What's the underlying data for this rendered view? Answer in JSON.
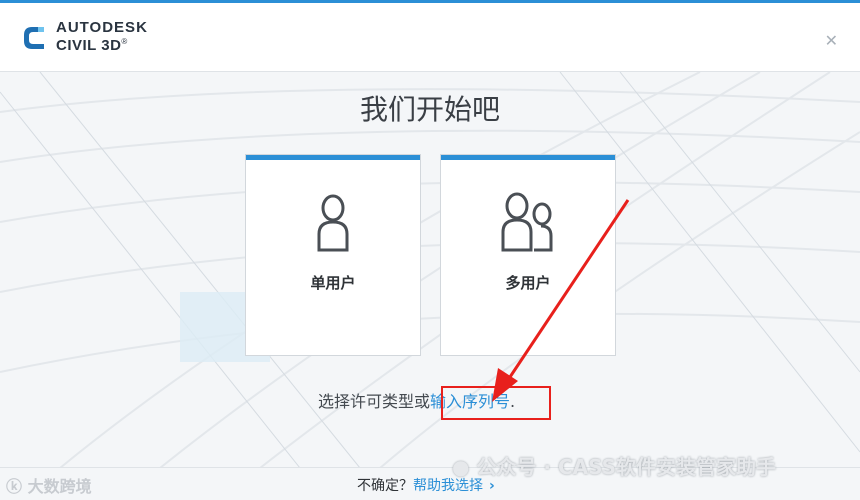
{
  "header": {
    "brand_line1": "AUTODESK",
    "brand_line2": "CIVIL 3D",
    "trademark": "®",
    "close_icon": "close-icon",
    "accent_color": "#2b8fd6"
  },
  "main": {
    "title": "我们开始吧",
    "cards": [
      {
        "label": "单用户",
        "icon": "single-user-icon"
      },
      {
        "label": "多用户",
        "icon": "multi-user-icon"
      }
    ],
    "license_prefix": "选择许可类型或",
    "license_link": "输入序列号",
    "license_suffix": "."
  },
  "footer": {
    "question": "不确定？",
    "help_link": "帮助我选择",
    "chevron_icon": "chevron-right-icon"
  },
  "watermarks": {
    "left": "大数跨境",
    "right": "公众号 · CASS软件安装管家助手"
  },
  "annotations": {
    "highlight_color": "#e8201c"
  }
}
